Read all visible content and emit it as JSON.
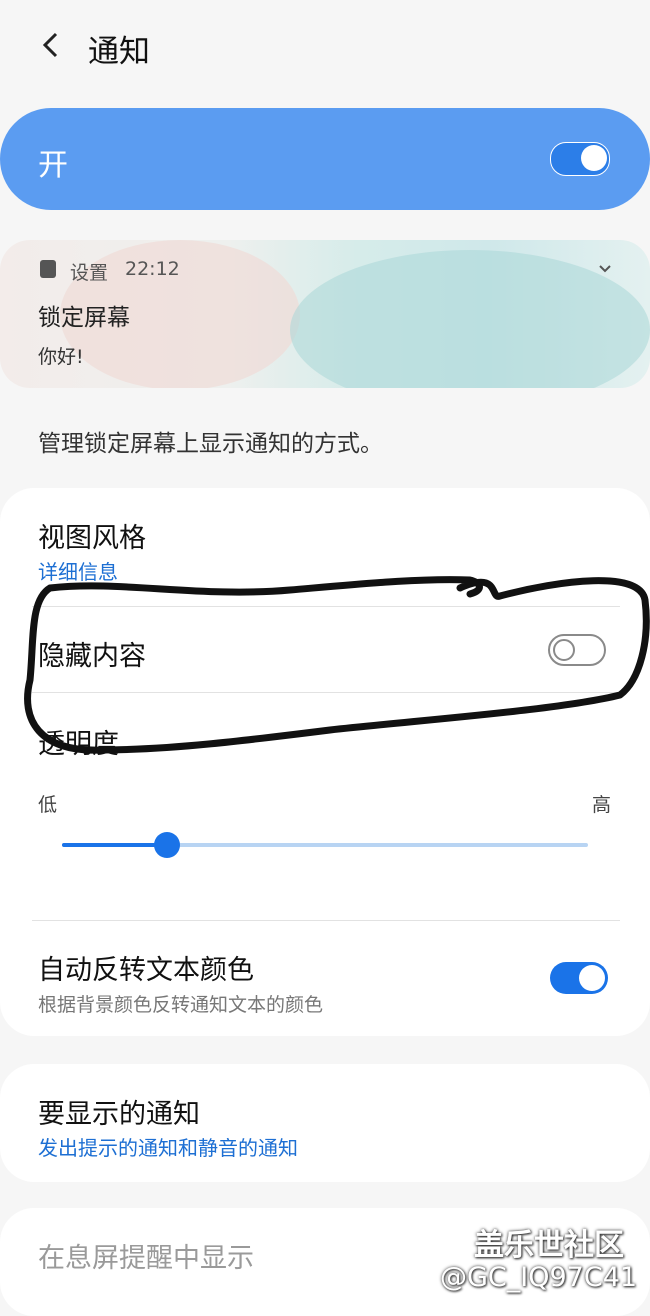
{
  "header": {
    "title": "通知"
  },
  "master": {
    "label": "开",
    "enabled": true
  },
  "preview": {
    "app": "设置",
    "time": "22:12",
    "title": "锁定屏幕",
    "message": "你好!"
  },
  "description": "管理锁定屏幕上显示通知的方式。",
  "settings": {
    "view_style": {
      "title": "视图风格",
      "value": "详细信息"
    },
    "hide_content": {
      "title": "隐藏内容",
      "enabled": false
    },
    "transparency": {
      "title": "透明度",
      "low": "低",
      "high": "高",
      "level_percent": 20
    },
    "auto_invert": {
      "title": "自动反转文本颜色",
      "subtitle": "根据背景颜色反转通知文本的颜色",
      "enabled": true
    }
  },
  "notifications_to_show": {
    "title": "要显示的通知",
    "value": "发出提示的通知和静音的通知"
  },
  "aod": {
    "title": "在息屏提醒中显示"
  },
  "watermark": {
    "line1": "盖乐世社区",
    "line2": "@GC_IQ97C41"
  },
  "colors": {
    "accent": "#1a73e8",
    "master_bg": "#5b9cf1",
    "link": "#1d6fd3"
  }
}
